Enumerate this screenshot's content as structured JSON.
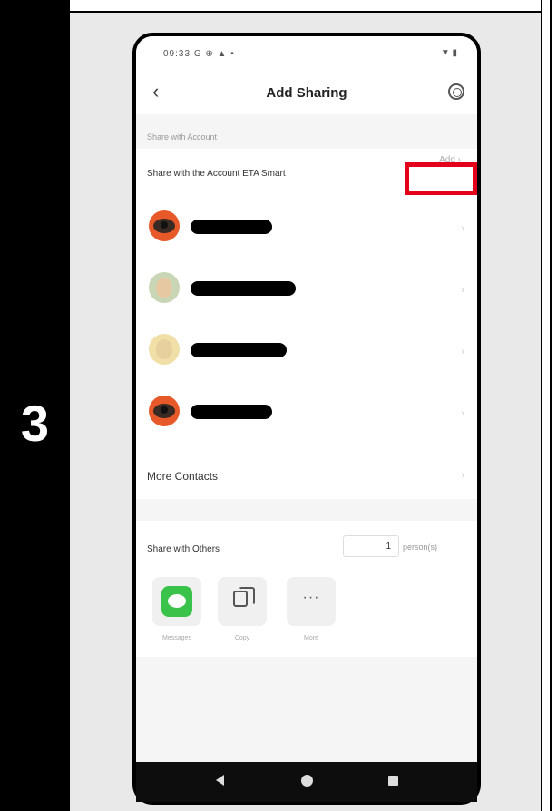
{
  "step": {
    "number": "3"
  },
  "statusbar": {
    "time": "09:33",
    "left_icons": "G ⊕ ▲ •",
    "right_icons": "▼ ▮"
  },
  "appbar": {
    "back_icon": "chevron-left-icon",
    "title": "Add Sharing",
    "settings_icon": "gear-icon"
  },
  "share_account": {
    "section_label": "Share with Account",
    "account_row_label": "Share with the Account ETA Smart",
    "add_label": "Add",
    "highlight_color": "#e4001b"
  },
  "contacts": [
    {
      "avatar": "eye-avatar",
      "name_redacted": true
    },
    {
      "avatar": "person-avatar",
      "name_redacted": true
    },
    {
      "avatar": "person-avatar",
      "name_redacted": true
    },
    {
      "avatar": "eye-avatar",
      "name_redacted": true
    }
  ],
  "more_contacts": {
    "label": "More Contacts"
  },
  "share_others": {
    "label": "Share with Others",
    "count": "1",
    "unit": "person(s)",
    "options": [
      {
        "label": "Messages",
        "icon": "messages-icon"
      },
      {
        "label": "Copy",
        "icon": "copy-icon"
      },
      {
        "label": "More",
        "icon": "more-icon"
      }
    ]
  },
  "android_nav": {
    "back": "back-icon",
    "home": "home-icon",
    "recents": "recents-icon"
  }
}
